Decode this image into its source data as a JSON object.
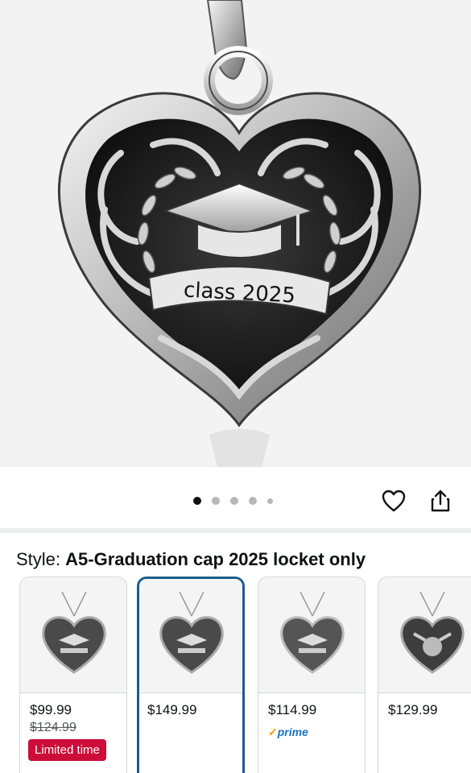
{
  "product": {
    "image_engraving": "class 2025",
    "gallery_dots": 5,
    "gallery_active_index": 0
  },
  "actions": {
    "wishlist_icon": "heart-outline-icon",
    "share_icon": "share-icon"
  },
  "style": {
    "label": "Style:",
    "selected_value": "A5-Graduation cap 2025 locket only"
  },
  "variants": [
    {
      "price": "$99.99",
      "was_price": "$124.99",
      "badge": "Limited time",
      "selected": false
    },
    {
      "price": "$149.99",
      "selected": true
    },
    {
      "price": "$114.99",
      "prime": "prime",
      "prime_check": "✓",
      "selected": false
    },
    {
      "price": "$129.99",
      "selected": false
    }
  ],
  "colors": {
    "accent_selected": "#1d5c8c",
    "deal_badge": "#cc0c39",
    "prime_blue": "#1a73c7"
  }
}
